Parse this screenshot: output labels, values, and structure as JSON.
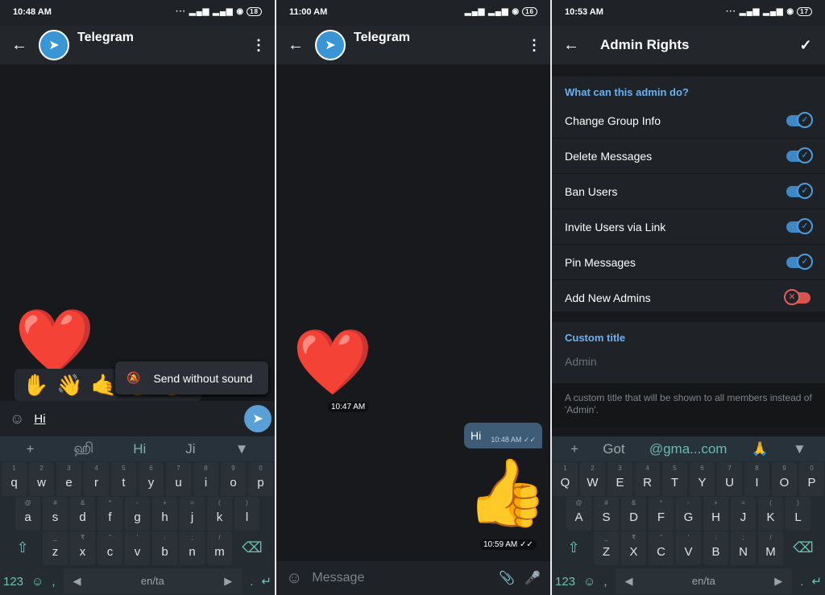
{
  "panels": [
    {
      "time": "10:48 AM",
      "battery": "18",
      "title": "Telegram"
    },
    {
      "time": "11:00 AM",
      "battery": "16",
      "title": "Telegram"
    },
    {
      "time": "10:53 AM",
      "battery": "17",
      "title": "Admin Rights"
    }
  ],
  "chat1": {
    "popup": "Send without sound",
    "input": "Hi",
    "emoji_suggestions": [
      "✋",
      "👋",
      "🤙",
      "😀",
      "😀"
    ],
    "sticker": "❤️"
  },
  "chat2": {
    "sticker1_time": "10:47 AM",
    "message": "Hi",
    "message_time": "10:48 AM",
    "sticker2": "👍",
    "sticker2_time": "10:59 AM",
    "placeholder": "Message"
  },
  "keyboard1": {
    "suggestions": [
      "+",
      "ஹி",
      "Hi",
      "Ji",
      "▼"
    ],
    "rows": [
      [
        "q",
        "w",
        "e",
        "r",
        "t",
        "y",
        "u",
        "i",
        "o",
        "p"
      ],
      [
        "a",
        "s",
        "d",
        "f",
        "g",
        "h",
        "j",
        "k",
        "l"
      ],
      [
        "z",
        "x",
        "c",
        "v",
        "b",
        "n",
        "m"
      ]
    ],
    "hints": [
      [
        "1",
        "2",
        "3",
        "4",
        "5",
        "6",
        "7",
        "8",
        "9",
        "0"
      ],
      [
        "@",
        "#",
        "&",
        "*",
        "-",
        "+",
        "=",
        "(",
        ")"
      ],
      [
        "_",
        "₹",
        "\"",
        "'",
        ":",
        ";",
        "/"
      ]
    ],
    "num": "123",
    "comma": ",",
    "space": "en/ta",
    "period": "."
  },
  "keyboard3": {
    "suggestions": [
      "+",
      "Got",
      "@gma...com",
      "🙏",
      "▼"
    ],
    "rows": [
      [
        "Q",
        "W",
        "E",
        "R",
        "T",
        "Y",
        "U",
        "I",
        "O",
        "P"
      ],
      [
        "A",
        "S",
        "D",
        "F",
        "G",
        "H",
        "J",
        "K",
        "L"
      ],
      [
        "Z",
        "X",
        "C",
        "V",
        "B",
        "N",
        "M"
      ]
    ],
    "hints": [
      [
        "1",
        "2",
        "3",
        "4",
        "5",
        "6",
        "7",
        "8",
        "9",
        "0"
      ],
      [
        "@",
        "#",
        "&",
        "*",
        "-",
        "+",
        "=",
        "(",
        ")"
      ],
      [
        "_",
        "₹",
        "\"",
        "'",
        ":",
        ";",
        "/"
      ]
    ],
    "num": "123",
    "comma": ",",
    "space": "en/ta",
    "period": "."
  },
  "admin": {
    "section_label": "What can this admin do?",
    "rights": [
      {
        "label": "Change Group Info",
        "enabled": true
      },
      {
        "label": "Delete Messages",
        "enabled": true
      },
      {
        "label": "Ban Users",
        "enabled": true
      },
      {
        "label": "Invite Users via Link",
        "enabled": true
      },
      {
        "label": "Pin Messages",
        "enabled": true
      },
      {
        "label": "Add New Admins",
        "enabled": false
      }
    ],
    "custom_title_label": "Custom title",
    "custom_title_placeholder": "Admin",
    "hint": "A custom title that will be shown to all members instead of 'Admin'."
  },
  "colors": {
    "accent": "#6ab2f2",
    "toggle_on": "#3e88c5",
    "toggle_off": "#d9534f",
    "keyboard_accent": "#6fc2b8"
  }
}
